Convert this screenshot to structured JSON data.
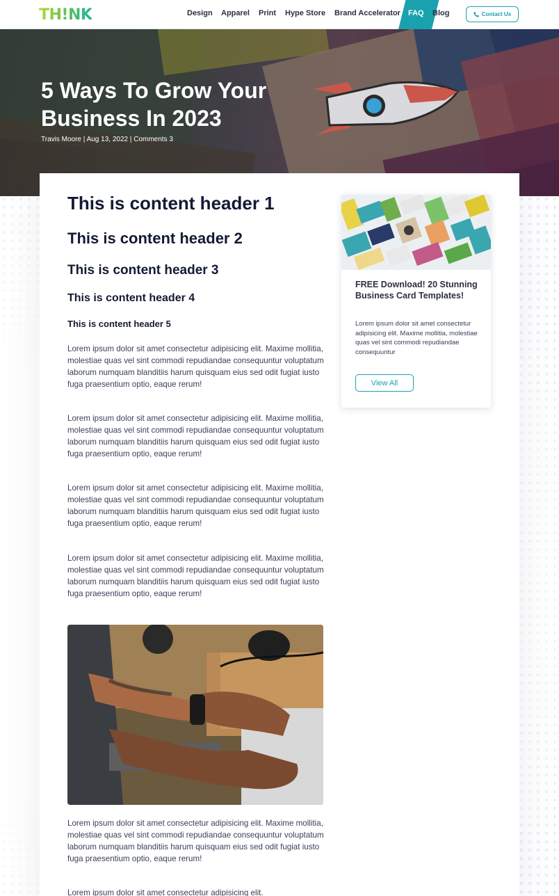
{
  "nav": {
    "logo": "TH!NK",
    "links": [
      "Design",
      "Apparel",
      "Print",
      "Hype Store",
      "Brand Accelerator",
      "FAQ",
      "Blog"
    ],
    "active": "FAQ",
    "contact_label": "Contact Us"
  },
  "hero": {
    "title": "5 Ways To Grow Your Business In 2023",
    "meta": "Travis Moore | Aug 13, 2022 | Comments 3"
  },
  "content": {
    "headers": [
      "This is content header 1",
      "This is content header 2",
      "This is content header 3",
      "This is content header 4",
      "This is content header 5"
    ],
    "paragraphs": [
      "Lorem ipsum dolor sit amet consectetur adipisicing elit. Maxime mollitia, molestiae quas vel sint commodi repudiandae consequuntur voluptatum laborum numquam blanditiis harum quisquam eius sed odit fugiat iusto fuga praesentium optio, eaque rerum!",
      "Lorem ipsum dolor sit amet consectetur adipisicing elit. Maxime mollitia, molestiae quas vel sint commodi repudiandae consequuntur voluptatum laborum numquam blanditiis harum quisquam eius sed odit fugiat iusto fuga praesentium optio, eaque rerum!",
      "Lorem ipsum dolor sit amet consectetur adipisicing elit. Maxime mollitia, molestiae quas vel sint commodi repudiandae consequuntur voluptatum laborum numquam blanditiis harum quisquam eius sed odit fugiat iusto fuga praesentium optio, eaque rerum!",
      "Lorem ipsum dolor sit amet consectetur adipisicing elit. Maxime mollitia, molestiae quas vel sint commodi repudiandae consequuntur voluptatum laborum numquam blanditiis harum quisquam eius sed odit fugiat iusto fuga praesentium optio, eaque rerum!",
      "Lorem ipsum dolor sit amet consectetur adipisicing elit. Maxime mollitia, molestiae quas vel sint commodi repudiandae consequuntur voluptatum laborum numquam blanditiis harum quisquam eius sed odit fugiat iusto fuga praesentium optio, eaque rerum!",
      "Lorem ipsum dolor sit amet consectetur adipisicing elit."
    ]
  },
  "sidebar": {
    "title": "FREE Download! 20 Stunning Business Card Templates!",
    "text": "Lorem ipsum dolor sit amet consectetur adipisicing elit. Maxime mollitia, molestiae quas vel sint commodi repudiandae consequuntur",
    "button_label": "View All"
  },
  "colors": {
    "accent": "#19a2ad",
    "logo_gradient": [
      "#b6d935",
      "#22b3a0"
    ],
    "heading": "#141a33"
  }
}
